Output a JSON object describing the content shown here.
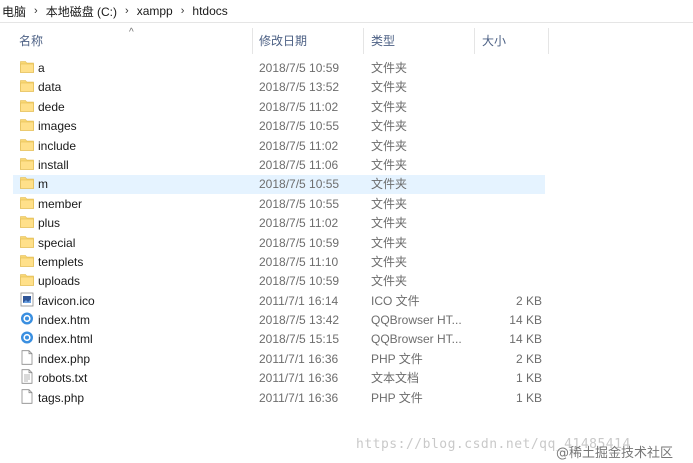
{
  "breadcrumb": [
    "电脑",
    "本地磁盘 (C:)",
    "xampp",
    "htdocs"
  ],
  "columns": {
    "name": "名称",
    "date": "修改日期",
    "type": "类型",
    "size": "大小"
  },
  "files": [
    {
      "name": "a",
      "date": "2018/7/5 10:59",
      "type": "文件夹",
      "size": "",
      "icon": "folder-icon"
    },
    {
      "name": "data",
      "date": "2018/7/5 13:52",
      "type": "文件夹",
      "size": "",
      "icon": "folder-icon"
    },
    {
      "name": "dede",
      "date": "2018/7/5 11:02",
      "type": "文件夹",
      "size": "",
      "icon": "folder-icon"
    },
    {
      "name": "images",
      "date": "2018/7/5 10:55",
      "type": "文件夹",
      "size": "",
      "icon": "folder-icon"
    },
    {
      "name": "include",
      "date": "2018/7/5 11:02",
      "type": "文件夹",
      "size": "",
      "icon": "folder-icon"
    },
    {
      "name": "install",
      "date": "2018/7/5 11:06",
      "type": "文件夹",
      "size": "",
      "icon": "folder-icon"
    },
    {
      "name": "m",
      "date": "2018/7/5 10:55",
      "type": "文件夹",
      "size": "",
      "icon": "folder-icon",
      "selected": true
    },
    {
      "name": "member",
      "date": "2018/7/5 10:55",
      "type": "文件夹",
      "size": "",
      "icon": "folder-icon"
    },
    {
      "name": "plus",
      "date": "2018/7/5 11:02",
      "type": "文件夹",
      "size": "",
      "icon": "folder-icon"
    },
    {
      "name": "special",
      "date": "2018/7/5 10:59",
      "type": "文件夹",
      "size": "",
      "icon": "folder-icon"
    },
    {
      "name": "templets",
      "date": "2018/7/5 11:10",
      "type": "文件夹",
      "size": "",
      "icon": "folder-icon"
    },
    {
      "name": "uploads",
      "date": "2018/7/5 10:59",
      "type": "文件夹",
      "size": "",
      "icon": "folder-icon"
    },
    {
      "name": "favicon.ico",
      "date": "2011/7/1 16:14",
      "type": "ICO 文件",
      "size": "2 KB",
      "icon": "image-file-icon"
    },
    {
      "name": "index.htm",
      "date": "2018/7/5 13:42",
      "type": "QQBrowser HT...",
      "size": "14 KB",
      "icon": "browser-icon"
    },
    {
      "name": "index.html",
      "date": "2018/7/5 15:15",
      "type": "QQBrowser HT...",
      "size": "14 KB",
      "icon": "browser-icon"
    },
    {
      "name": "index.php",
      "date": "2011/7/1 16:36",
      "type": "PHP 文件",
      "size": "2 KB",
      "icon": "file-icon"
    },
    {
      "name": "robots.txt",
      "date": "2011/7/1 16:36",
      "type": "文本文档",
      "size": "1 KB",
      "icon": "text-file-icon"
    },
    {
      "name": "tags.php",
      "date": "2011/7/1 16:36",
      "type": "PHP 文件",
      "size": "1 KB",
      "icon": "file-icon"
    }
  ],
  "watermark": "https://blog.csdn.net/qq_41485414",
  "watermark_site": "@稀土掘金技术社区"
}
